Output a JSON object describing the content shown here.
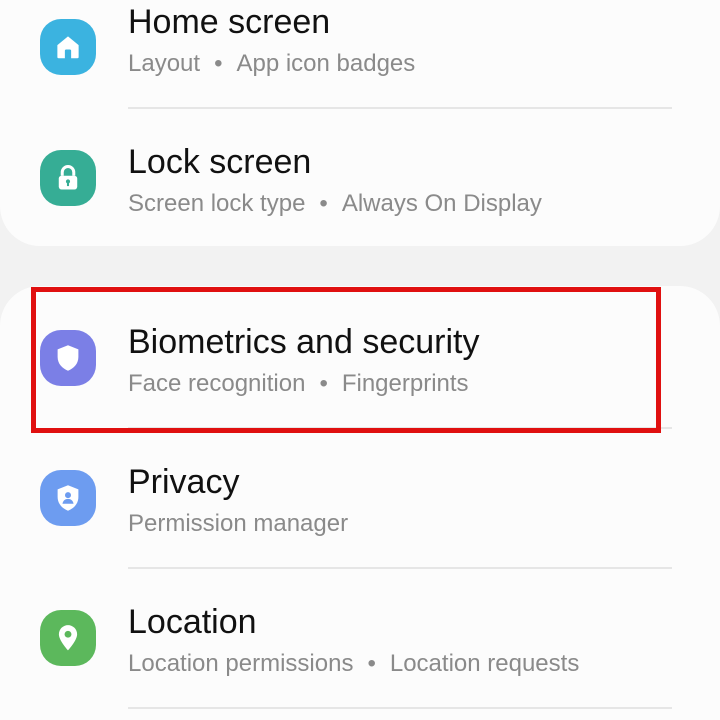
{
  "settings_items": [
    {
      "title": "Home screen",
      "subtitle": [
        "Layout",
        "App icon badges"
      ],
      "icon": "home-icon",
      "icon_color": "#3bb3e0"
    },
    {
      "title": "Lock screen",
      "subtitle": [
        "Screen lock type",
        "Always On Display"
      ],
      "icon": "lock-icon",
      "icon_color": "#36ad95"
    },
    {
      "title": "Biometrics and security",
      "subtitle": [
        "Face recognition",
        "Fingerprints"
      ],
      "icon": "shield-icon",
      "icon_color": "#7b7fe6"
    },
    {
      "title": "Privacy",
      "subtitle": [
        "Permission manager"
      ],
      "icon": "privacy-icon",
      "icon_color": "#6d9cf0"
    },
    {
      "title": "Location",
      "subtitle": [
        "Location permissions",
        "Location requests"
      ],
      "icon": "location-pin-icon",
      "icon_color": "#5cb85c"
    }
  ],
  "subtitle_separator": "•",
  "highlight": {
    "target": "Biometrics and security",
    "color": "#e01010"
  }
}
